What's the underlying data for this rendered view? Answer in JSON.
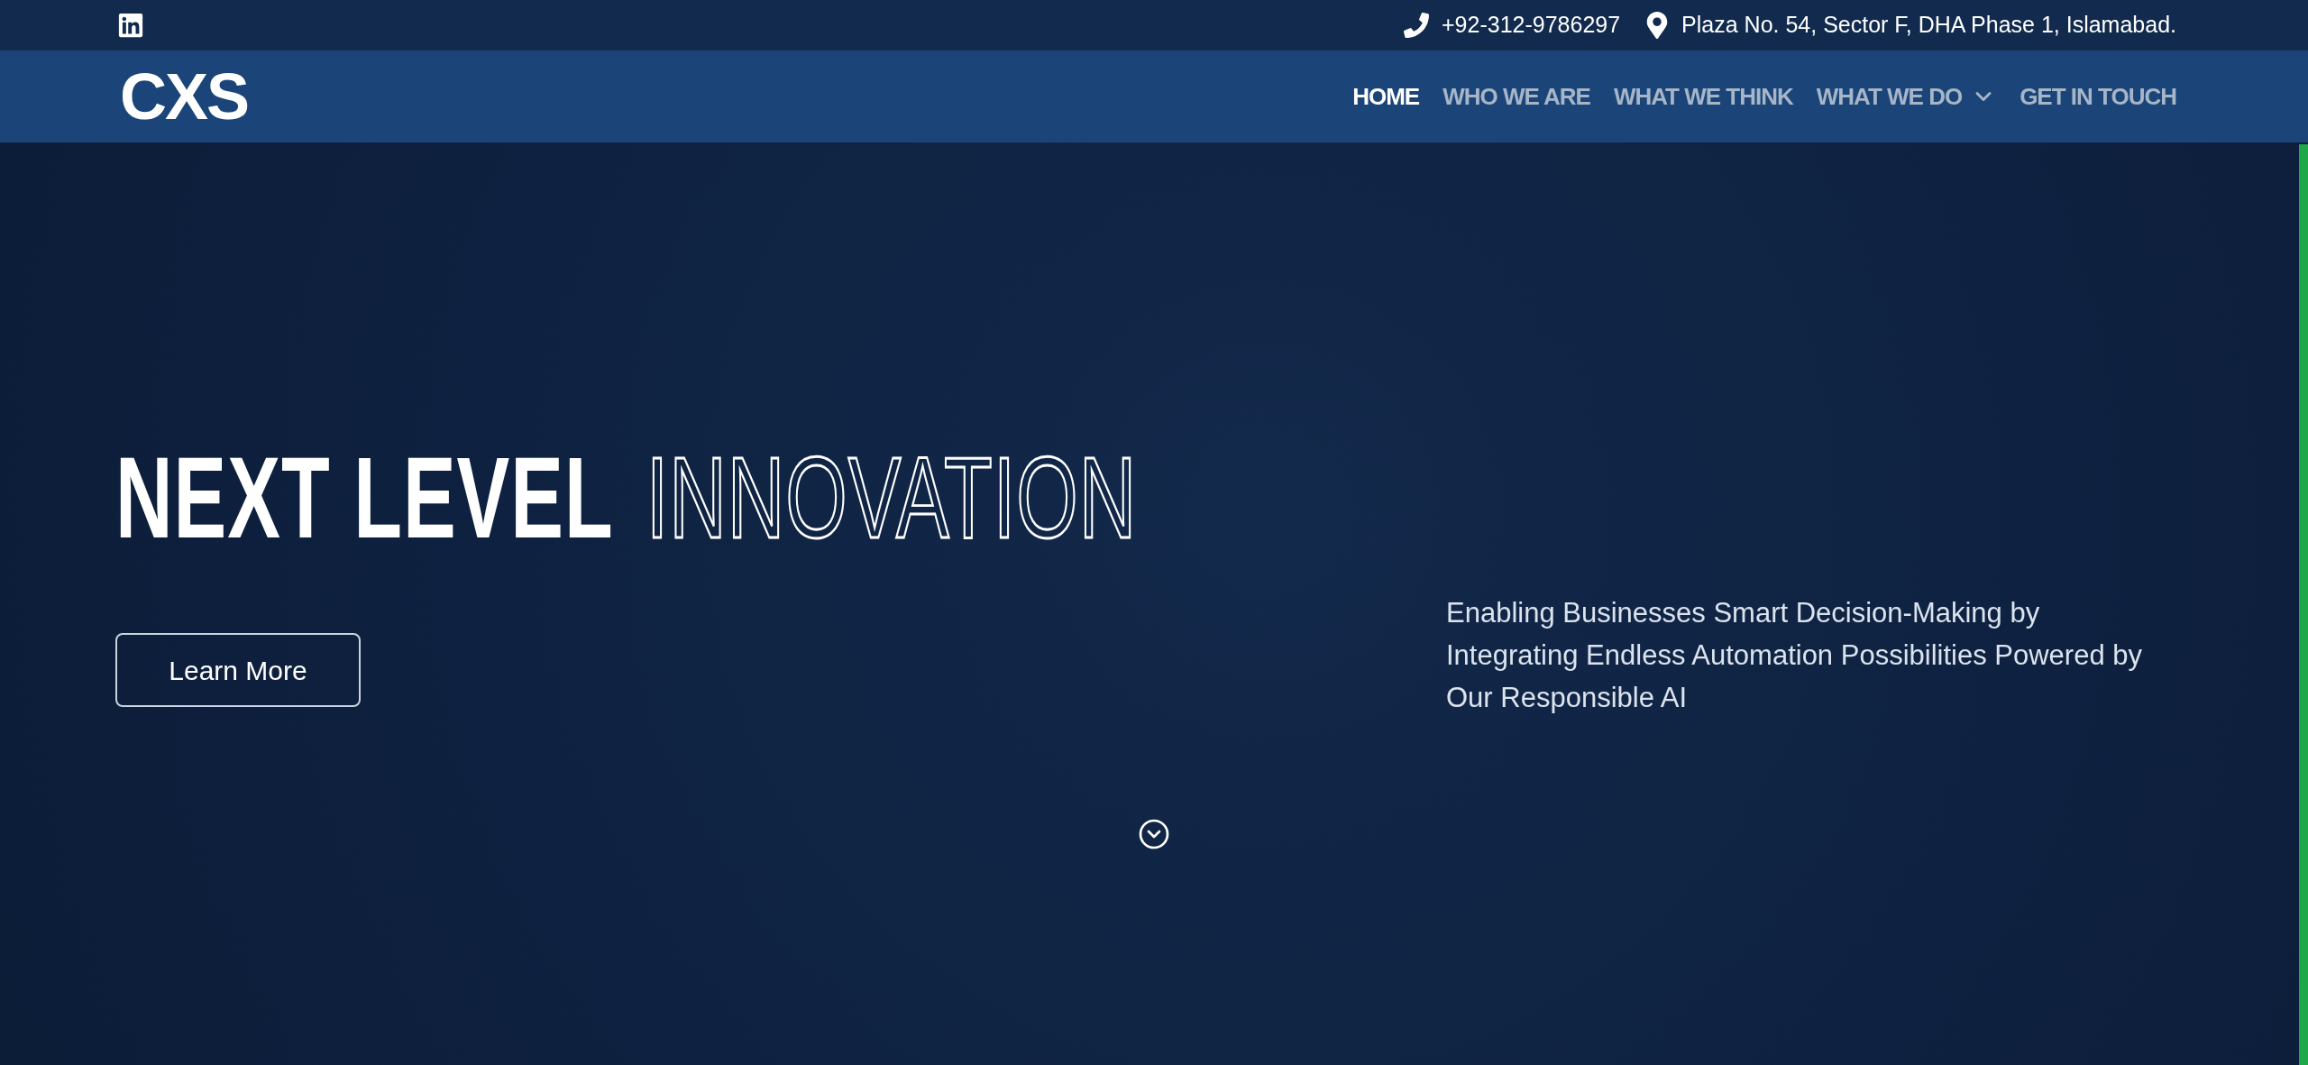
{
  "top_bar": {
    "phone": "+92-312-9786297",
    "address": "Plaza No. 54, Sector F, DHA Phase 1, Islamabad."
  },
  "header": {
    "logo": "CXS",
    "nav": [
      {
        "label": "HOME",
        "selected": true,
        "dropdown": false
      },
      {
        "label": "WHO WE ARE",
        "selected": false,
        "dropdown": false
      },
      {
        "label": "WHAT WE THINK",
        "selected": false,
        "dropdown": false
      },
      {
        "label": "WHAT WE DO",
        "selected": false,
        "dropdown": true
      },
      {
        "label": "GET IN TOUCH",
        "selected": false,
        "dropdown": false
      }
    ]
  },
  "hero": {
    "headline_solid": "NEXT LEVEL",
    "headline_outline": "INNOVATION",
    "button": "Learn More",
    "description": "Enabling Businesses Smart Decision-Making by Integrating Endless Automation Possibilities Powered by Our Responsible AI"
  }
}
